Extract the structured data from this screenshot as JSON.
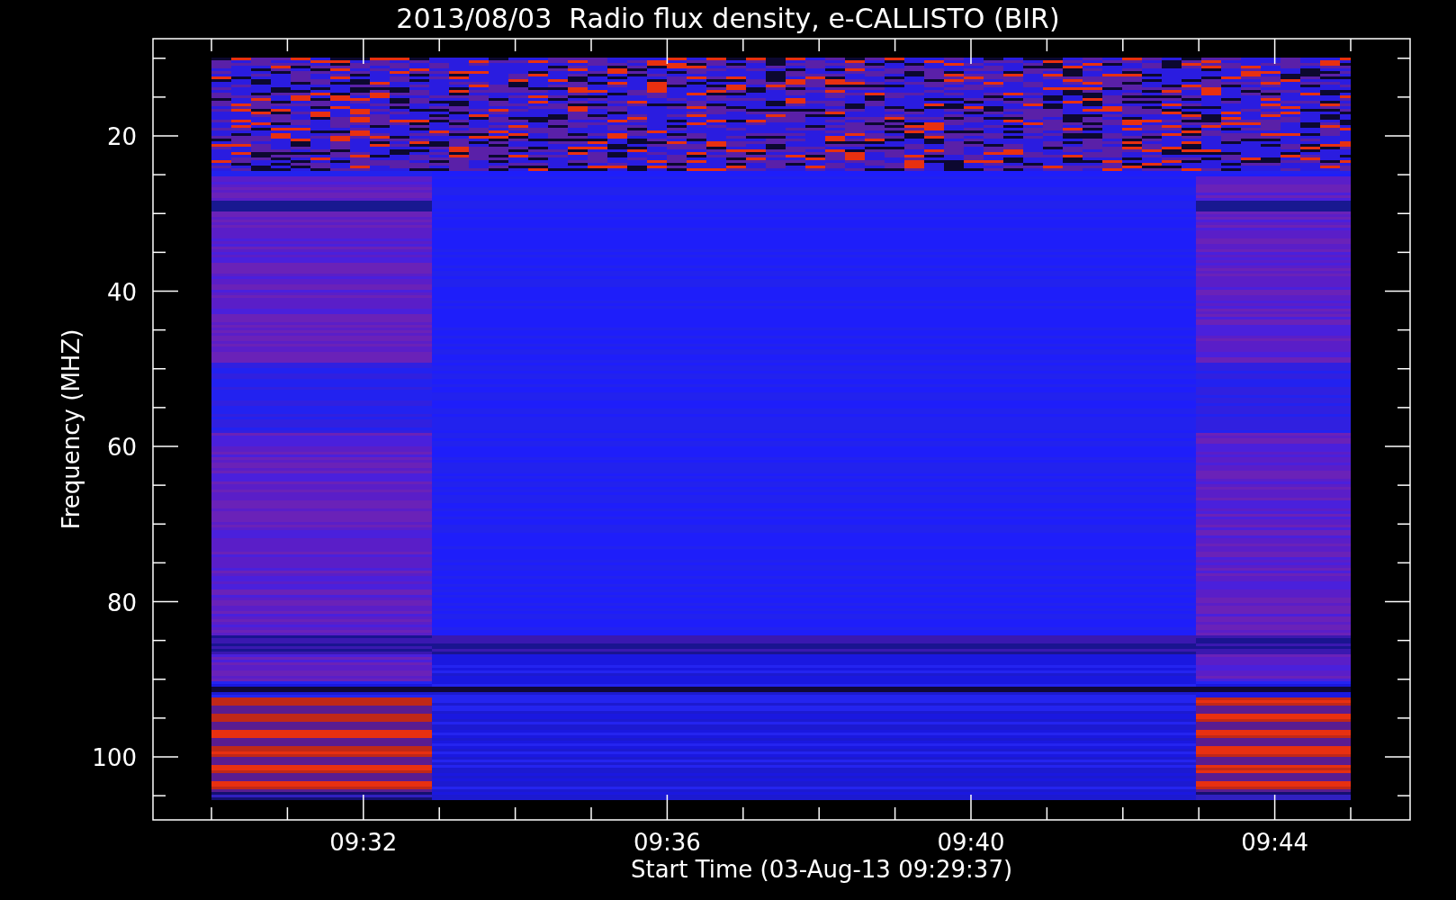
{
  "title": "2013/08/03  Radio flux density, e-CALLISTO (BIR)",
  "y_axis": {
    "label": "Frequency (MHZ)",
    "ticks": [
      "20",
      "40",
      "60",
      "80",
      "100"
    ]
  },
  "x_axis": {
    "label": "Start Time (03-Aug-13 09:29:37)",
    "ticks": [
      "09:32",
      "09:36",
      "09:40",
      "09:44"
    ]
  }
}
